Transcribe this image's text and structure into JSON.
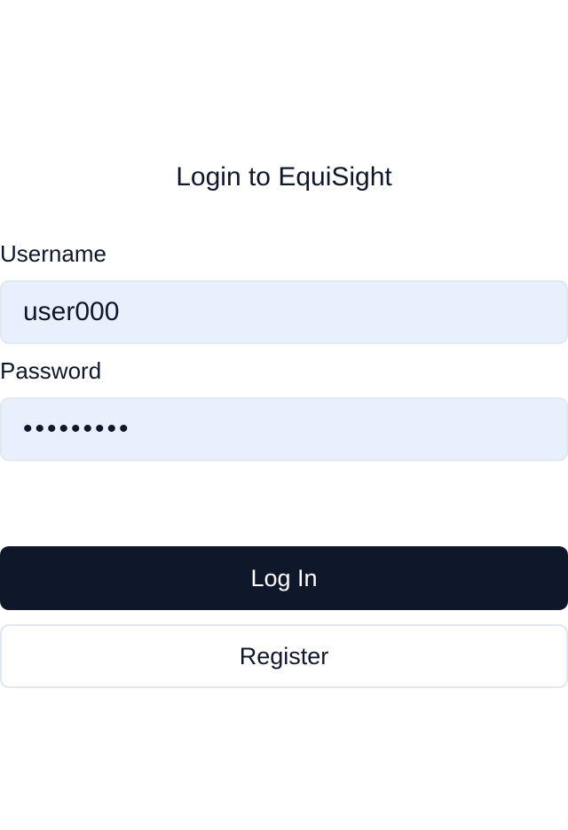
{
  "login": {
    "title": "Login to EquiSight",
    "username": {
      "label": "Username",
      "value": "user000"
    },
    "password": {
      "label": "Password",
      "value": "user000pw"
    },
    "login_button": "Log In",
    "register_button": "Register"
  },
  "colors": {
    "primary": "#0f172a",
    "input_background": "#e8f0fe",
    "border": "#e2e8f0",
    "background": "#ffffff"
  }
}
